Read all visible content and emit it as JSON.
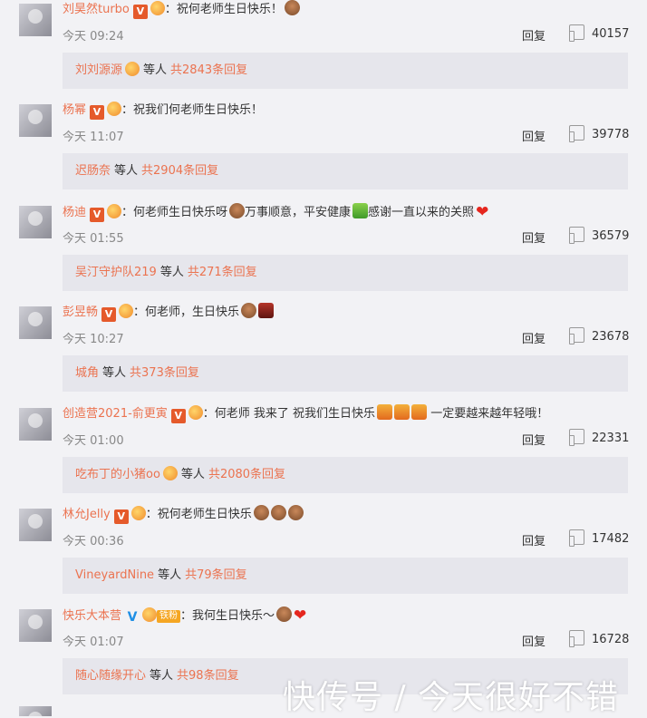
{
  "comments": [
    {
      "name": "刘昊然turbo",
      "verified": "V",
      "text": "：祝何老师生日快乐！",
      "time": "今天 09:24",
      "reply": "回复",
      "likes": "40157",
      "sub_name": "刘刘源源",
      "sub_etc": "等人",
      "sub_total": "共2843条回复"
    },
    {
      "name": "杨幂",
      "verified": "V",
      "text": "：祝我们何老师生日快乐！",
      "time": "今天 11:07",
      "reply": "回复",
      "likes": "39778",
      "sub_name": "迟肠奈",
      "sub_etc": "等人",
      "sub_total": "共2904条回复"
    },
    {
      "name": "杨迪",
      "verified": "V",
      "text1": "：何老师生日快乐呀",
      "text2": "万事顺意，平安健康",
      "text3": "感谢一直以来的关照",
      "time": "今天 01:55",
      "reply": "回复",
      "likes": "36579",
      "sub_name": "吴汀守护队219",
      "sub_etc": "等人",
      "sub_total": "共271条回复"
    },
    {
      "name": "彭昱畅",
      "verified": "V",
      "text": "：何老师，生日快乐",
      "time": "今天 10:27",
      "reply": "回复",
      "likes": "23678",
      "sub_name": "城角",
      "sub_etc": "等人",
      "sub_total": "共373条回复"
    },
    {
      "name": "创造营2021-俞更寅",
      "verified": "V",
      "text1": "：何老师 我来了 祝我们生日快乐",
      "text2": "一定要越来越年轻哦！",
      "time": "今天 01:00",
      "reply": "回复",
      "likes": "22331",
      "sub_name": "吃布丁的小猪oo",
      "sub_etc": "等人",
      "sub_total": "共2080条回复"
    },
    {
      "name": "林允Jelly",
      "verified": "V",
      "text": "：祝何老师生日快乐",
      "time": "今天 00:36",
      "reply": "回复",
      "likes": "17482",
      "sub_name": "VineyardNine",
      "sub_etc": "等人",
      "sub_total": "共79条回复"
    },
    {
      "name": "快乐大本营",
      "verified": "V",
      "tag": "铁粉",
      "text": "：我何生日快乐～",
      "time": "今天 01:07",
      "reply": "回复",
      "likes": "16728",
      "sub_name": "随心随缘开心",
      "sub_etc": "等人",
      "sub_total": "共98条回复"
    }
  ],
  "watermark": "快传号 / 今天很好不错",
  "colors": {
    "accent": "#eb7350",
    "background": "#f2f2f5",
    "sub_background": "#e6e6ec",
    "badge": "#e55a2b",
    "badge_blue": "#1f8fe5"
  },
  "icons": [
    "verified-badge-icon",
    "fan-medal-icon",
    "cake-emoji-icon",
    "heart-emoji-icon",
    "gift-emoji-icon",
    "thumbs-up-icon"
  ]
}
